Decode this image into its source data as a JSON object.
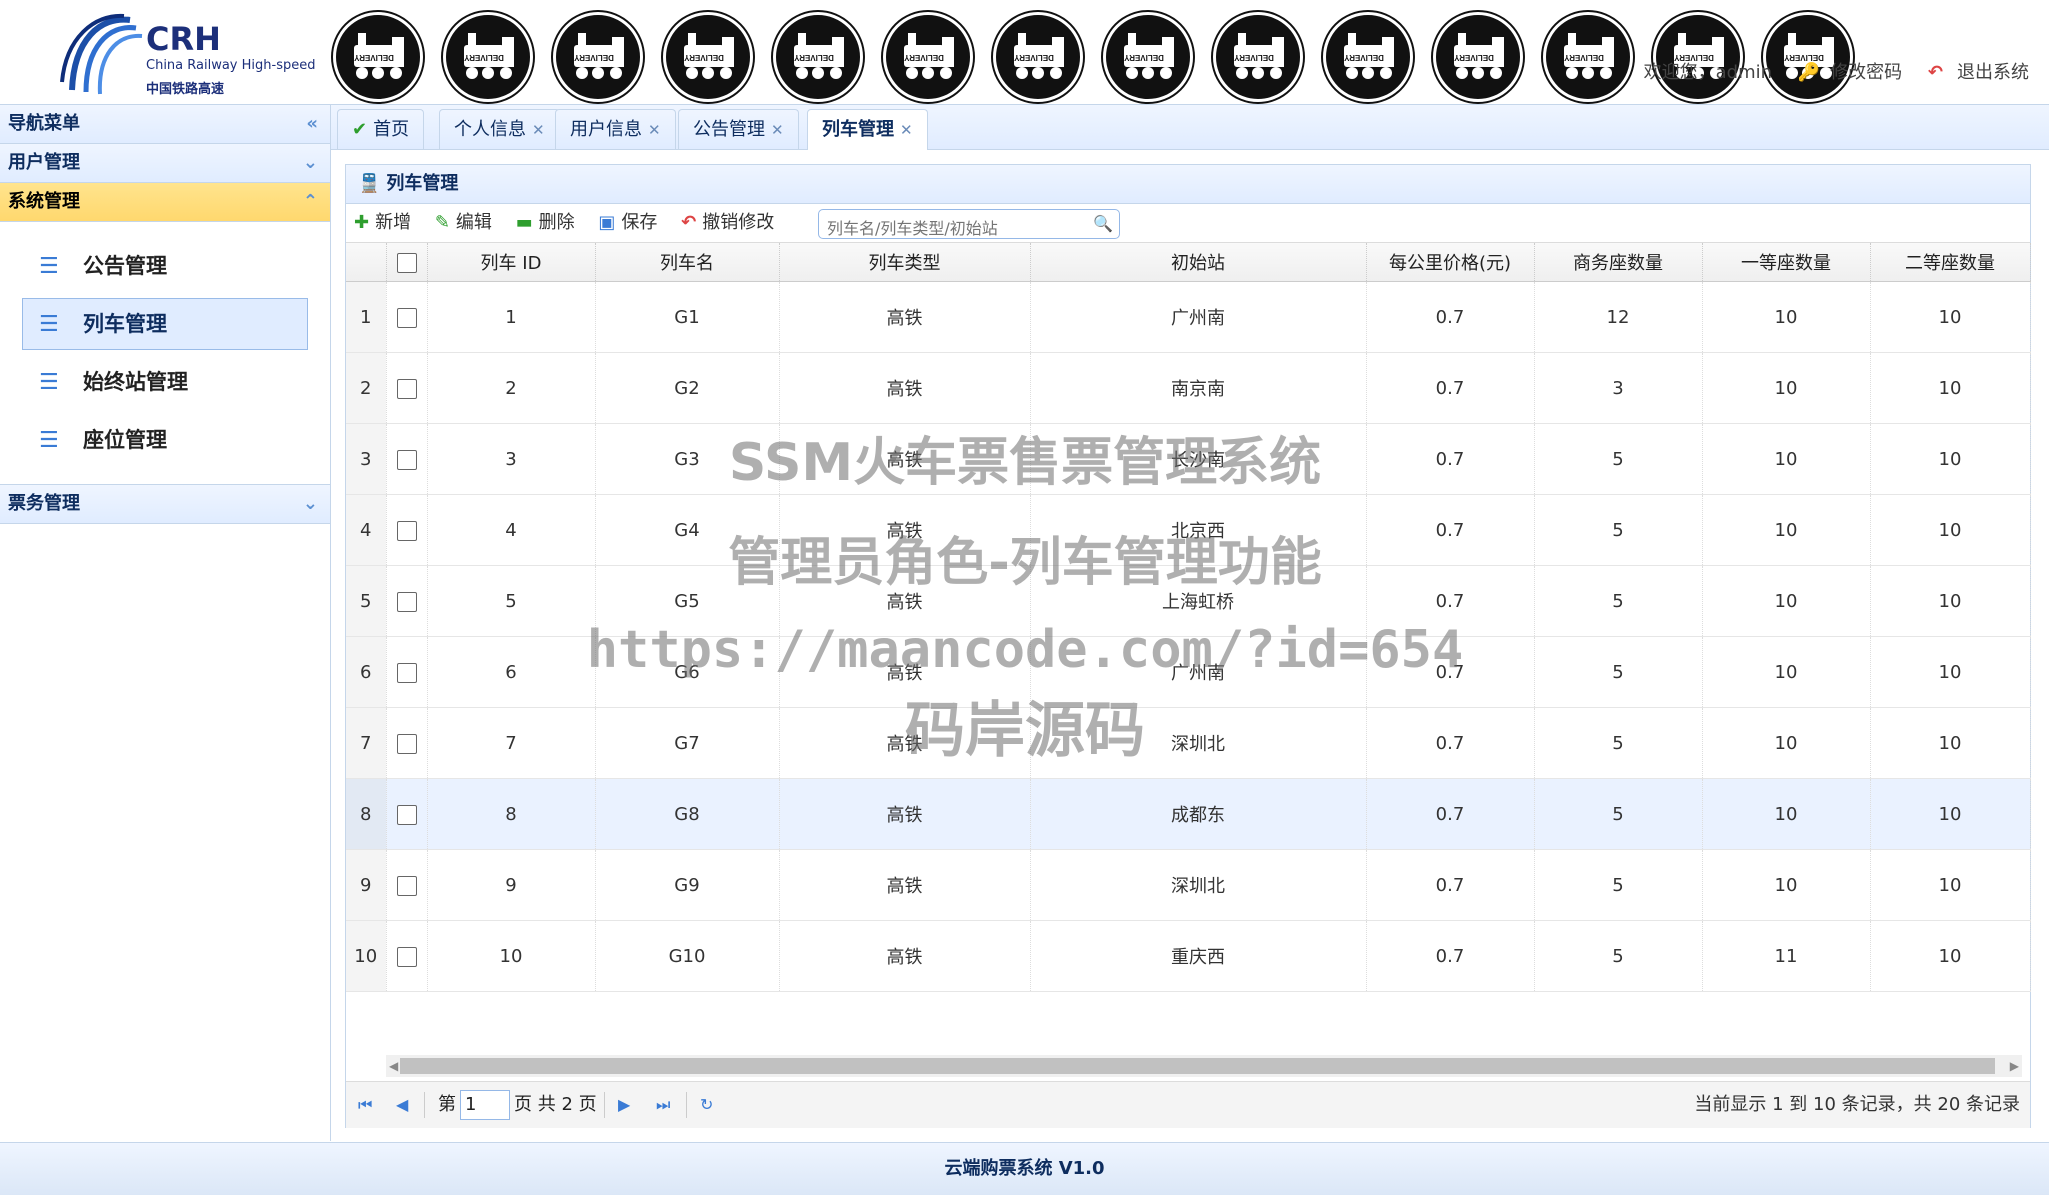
{
  "logo": {
    "crh": "CRH",
    "english": "China Railway High-speed",
    "chinese": "中国铁路高速"
  },
  "header": {
    "user_text": "欢迎您，admin",
    "change_password": "修改密码",
    "logout": "退出系统",
    "badge_text": "DELIVERY"
  },
  "sidebar": {
    "title": "导航菜单",
    "groups": [
      {
        "label": "用户管理"
      },
      {
        "label": "系统管理",
        "items": [
          "公告管理",
          "列车管理",
          "始终站管理",
          "座位管理"
        ]
      },
      {
        "label": "票务管理"
      }
    ]
  },
  "tabs": [
    "首页",
    "个人信息",
    "用户信息",
    "公告管理",
    "列车管理"
  ],
  "panel": {
    "title": "列车管理"
  },
  "toolbar": {
    "add": "新增",
    "edit": "编辑",
    "delete": "删除",
    "save": "保存",
    "undo": "撤销修改",
    "search_placeholder": "列车名/列车类型/初始站"
  },
  "table": {
    "columns": [
      "列车 ID",
      "列车名",
      "列车类型",
      "初始站",
      "每公里价格(元)",
      "商务座数量",
      "一等座数量",
      "二等座数量"
    ],
    "rows": [
      [
        "1",
        "1",
        "G1",
        "高铁",
        "广州南",
        "0.7",
        "12",
        "10",
        "10"
      ],
      [
        "2",
        "2",
        "G2",
        "高铁",
        "南京南",
        "0.7",
        "3",
        "10",
        "10"
      ],
      [
        "3",
        "3",
        "G3",
        "高铁",
        "长沙南",
        "0.7",
        "5",
        "10",
        "10"
      ],
      [
        "4",
        "4",
        "G4",
        "高铁",
        "北京西",
        "0.7",
        "5",
        "10",
        "10"
      ],
      [
        "5",
        "5",
        "G5",
        "高铁",
        "上海虹桥",
        "0.7",
        "5",
        "10",
        "10"
      ],
      [
        "6",
        "6",
        "G6",
        "高铁",
        "广州南",
        "0.7",
        "5",
        "10",
        "10"
      ],
      [
        "7",
        "7",
        "G7",
        "高铁",
        "深圳北",
        "0.7",
        "5",
        "10",
        "10"
      ],
      [
        "8",
        "8",
        "G8",
        "高铁",
        "成都东",
        "0.7",
        "5",
        "10",
        "10"
      ],
      [
        "9",
        "9",
        "G9",
        "高铁",
        "深圳北",
        "0.7",
        "5",
        "10",
        "10"
      ],
      [
        "10",
        "10",
        "G10",
        "高铁",
        "重庆西",
        "0.7",
        "5",
        "11",
        "10"
      ]
    ]
  },
  "pager": {
    "page_prefix": "第",
    "page_value": "1",
    "page_suffix": "页 共 2 页",
    "info": "当前显示 1 到 10 条记录，共 20 条记录"
  },
  "footer": "云端购票系统 V1.0",
  "watermark": [
    "SSM火车票售票管理系统",
    "管理员角色-列车管理功能",
    "https://maancode.com/?id=654",
    "码岸源码"
  ]
}
